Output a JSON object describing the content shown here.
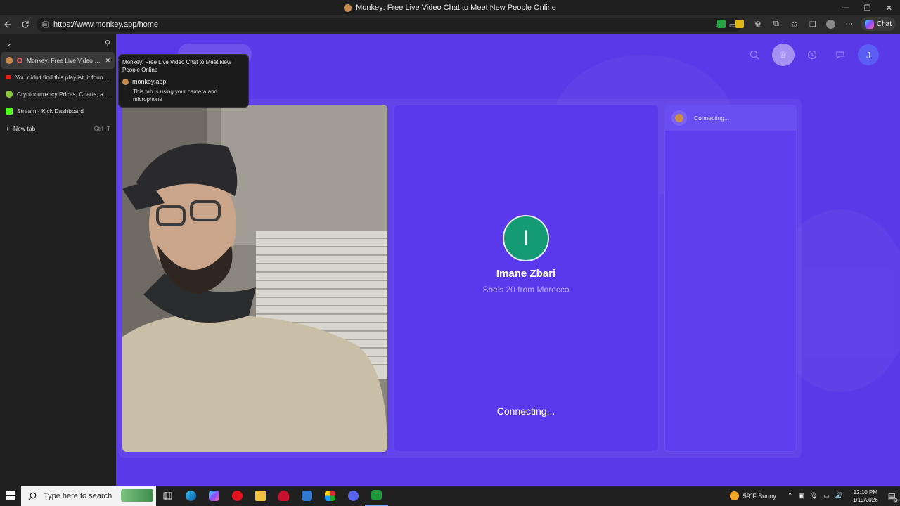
{
  "window": {
    "title": "Monkey: Free Live Video Chat to Meet New People Online",
    "controls": [
      "—",
      "❐",
      "✕"
    ]
  },
  "browser": {
    "url": "https://www.monkey.app/home",
    "chat_label": "Chat"
  },
  "sidebar": {
    "tabs": [
      {
        "label": "Monkey: Free Live Video Chat to Meet New People Online",
        "favicon_color": "#c98a4b",
        "active": true
      },
      {
        "label": "You didn't find this playlist, it found you",
        "favicon_color": "#e62117",
        "active": false
      },
      {
        "label": "Cryptocurrency Prices, Charts, and Crypto Market Cap",
        "favicon_color": "#8dc63f",
        "active": false
      },
      {
        "label": "Stream - Kick Dashboard",
        "favicon_color": "#53fc18",
        "active": false
      }
    ],
    "new_tab_label": "New tab",
    "new_tab_shortcut": "Ctrl+T"
  },
  "tooltip": {
    "title": "Monkey: Free Live Video Chat to Meet New People Online",
    "site": "monkey.app",
    "note": "This tab is using your camera and microphone"
  },
  "peer": {
    "initial": "I",
    "name": "Imane Zbari",
    "subtitle": "She's 20 from Morocco",
    "status": "Connecting...",
    "avatar_color": "#149b74"
  },
  "chat": {
    "status": "Connecting..."
  },
  "taskbar": {
    "search_placeholder": "Type here to search",
    "weather": "59°F  Sunny",
    "time": "12:10 PM",
    "date": "1/19/2026",
    "notification_count": "3"
  },
  "colors": {
    "page_background": "#5a3ae8",
    "accent": "#5a39ec"
  }
}
